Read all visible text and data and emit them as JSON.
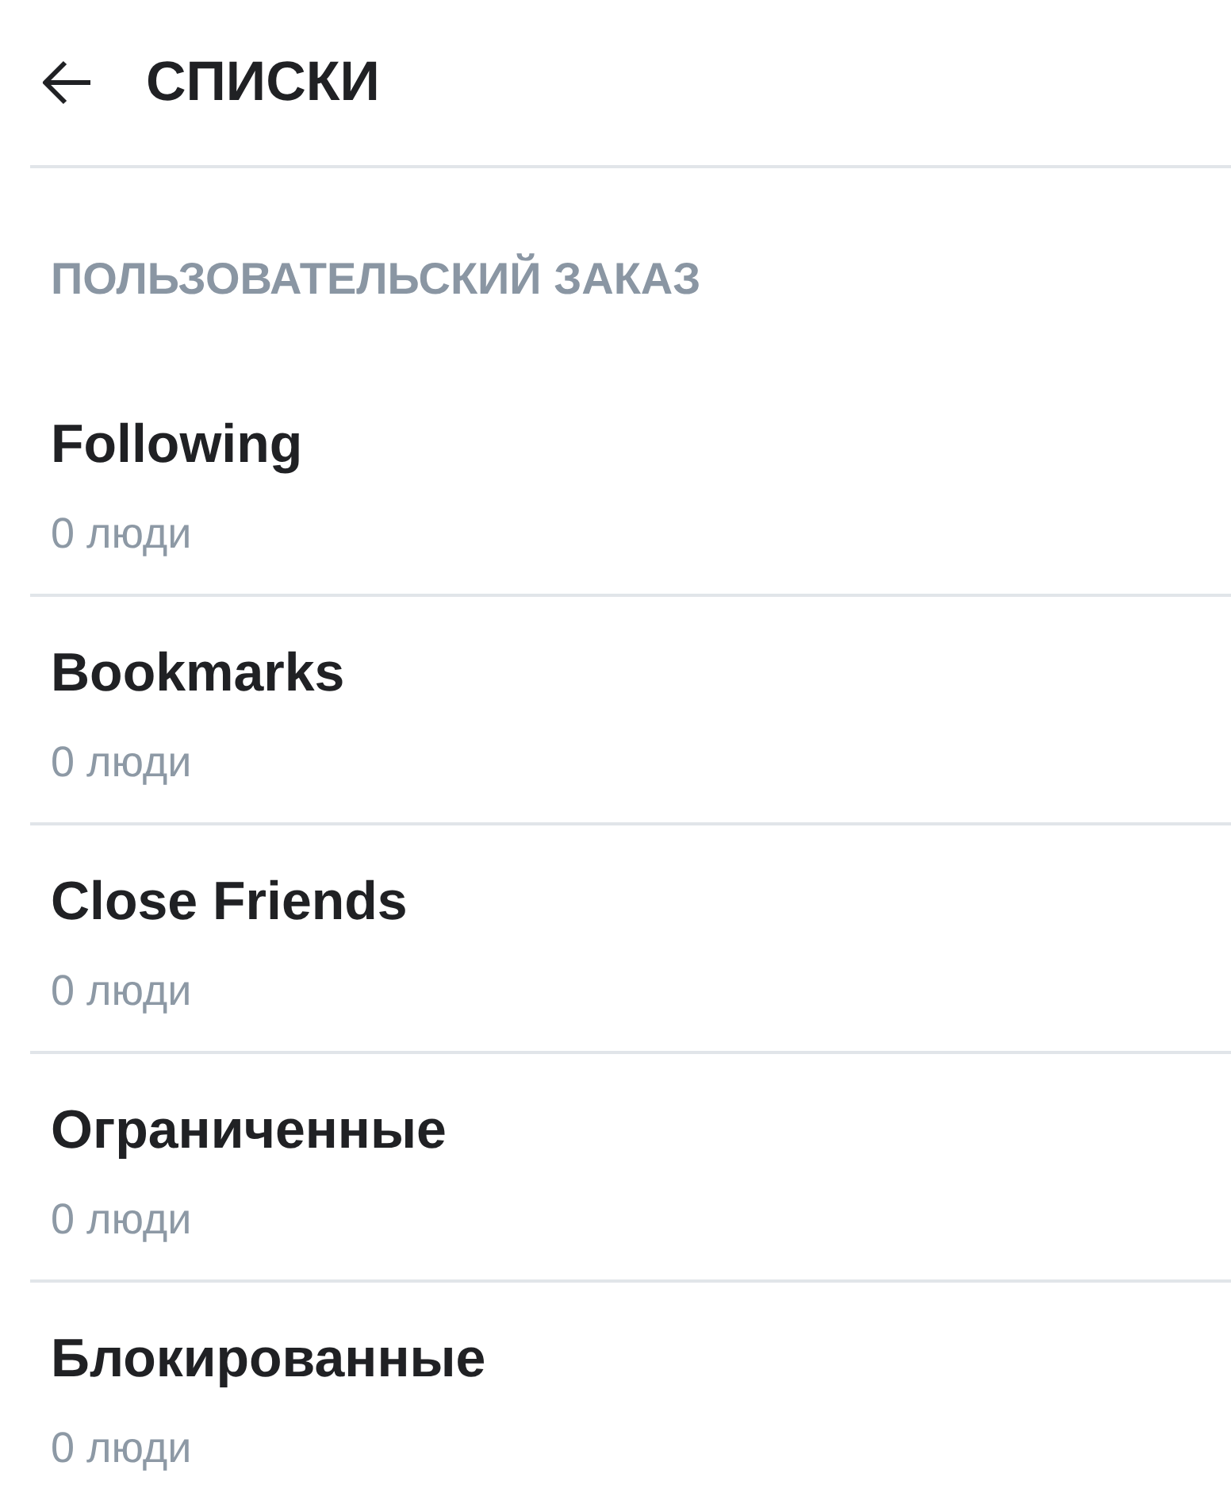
{
  "header": {
    "title": "СПИСКИ"
  },
  "section": {
    "label": "ПОЛЬЗОВАТЕЛЬСКИЙ ЗАКАЗ"
  },
  "lists": [
    {
      "name": "Following",
      "count": "0 люди"
    },
    {
      "name": "Bookmarks",
      "count": "0 люди"
    },
    {
      "name": "Close Friends",
      "count": "0 люди"
    },
    {
      "name": "Ограниченные",
      "count": "0 люди"
    },
    {
      "name": "Блокированные",
      "count": "0 люди"
    }
  ]
}
